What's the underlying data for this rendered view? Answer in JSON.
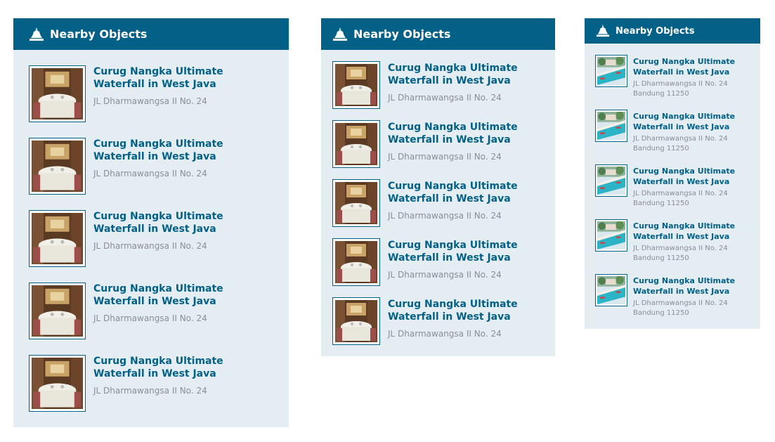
{
  "colors": {
    "header": "#036087",
    "panel": "#e4edf2",
    "title": "#036087",
    "address": "#8a8f93"
  },
  "widgets": [
    {
      "header_icon": "temple-stupa-icon",
      "title": "Nearby Objects",
      "thumb_style": "dining-room",
      "items": [
        {
          "name": "Curug Nangka Ultimate Waterfall in West Java",
          "address": "JL Dharmawangsa II No. 24"
        },
        {
          "name": "Curug Nangka Ultimate Waterfall in West Java",
          "address": "JL Dharmawangsa II No. 24"
        },
        {
          "name": "Curug Nangka Ultimate Waterfall in West Java",
          "address": "JL Dharmawangsa II No. 24"
        },
        {
          "name": "Curug Nangka Ultimate Waterfall in West Java",
          "address": "JL Dharmawangsa II No. 24"
        },
        {
          "name": "Curug Nangka Ultimate Waterfall in West Java",
          "address": "JL Dharmawangsa II No. 24"
        }
      ]
    },
    {
      "header_icon": "temple-stupa-icon",
      "title": "Nearby Objects",
      "thumb_style": "dining-room",
      "items": [
        {
          "name": "Curug Nangka Ultimate Waterfall in West Java",
          "address": "JL Dharmawangsa II No. 24"
        },
        {
          "name": "Curug Nangka Ultimate Waterfall in West Java",
          "address": "JL Dharmawangsa II No. 24"
        },
        {
          "name": "Curug Nangka Ultimate Waterfall in West Java",
          "address": "JL Dharmawangsa II No. 24"
        },
        {
          "name": "Curug Nangka Ultimate Waterfall in West Java",
          "address": "JL Dharmawangsa II No. 24"
        },
        {
          "name": "Curug Nangka Ultimate Waterfall in West Java",
          "address": "JL Dharmawangsa II No. 24"
        }
      ]
    },
    {
      "header_icon": "temple-stupa-icon",
      "title": "Nearby Objects",
      "thumb_style": "pool-resort",
      "items": [
        {
          "name": "Curug Nangka Ultimate Waterfall in West Java",
          "address": "JL Dharmawangsa II No. 24 Bandung 11250"
        },
        {
          "name": "Curug Nangka Ultimate Waterfall in West Java",
          "address": "JL Dharmawangsa II No. 24 Bandung 11250"
        },
        {
          "name": "Curug Nangka Ultimate Waterfall in West Java",
          "address": "JL Dharmawangsa II No. 24 Bandung 11250"
        },
        {
          "name": "Curug Nangka Ultimate Waterfall in West Java",
          "address": "JL Dharmawangsa II No. 24 Bandung 11250"
        },
        {
          "name": "Curug Nangka Ultimate Waterfall in West Java",
          "address": "JL Dharmawangsa II No. 24 Bandung 11250"
        }
      ]
    }
  ]
}
